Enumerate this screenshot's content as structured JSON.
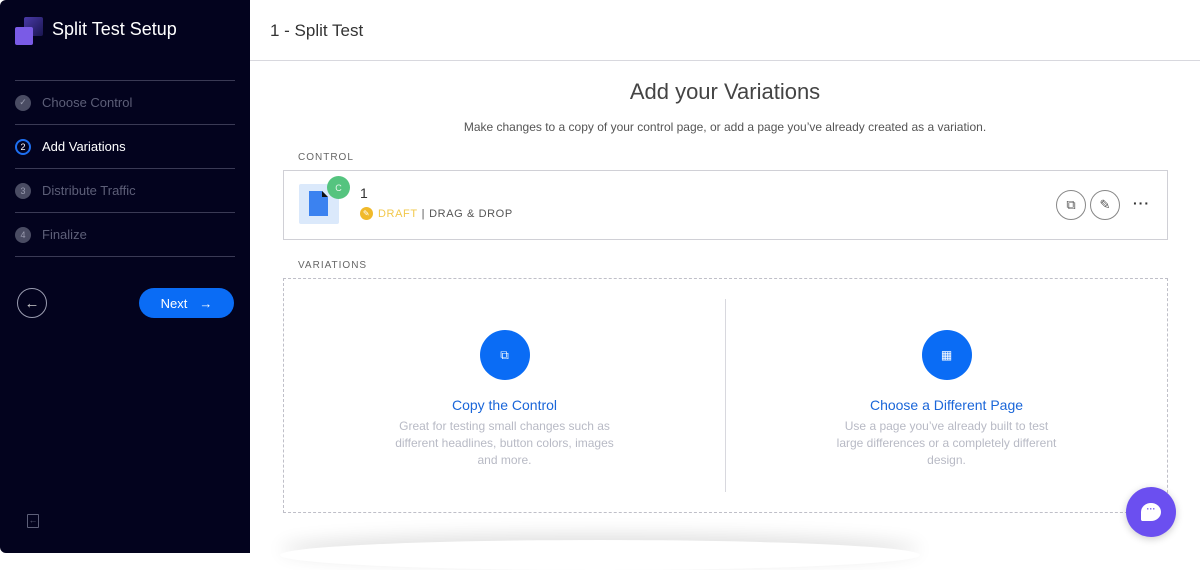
{
  "sidebar": {
    "app_title": "Split Test Setup",
    "steps": [
      {
        "num": "✓",
        "label": "Choose Control",
        "state": "done"
      },
      {
        "num": "2",
        "label": "Add Variations",
        "state": "active"
      },
      {
        "num": "3",
        "label": "Distribute Traffic",
        "state": "pending"
      },
      {
        "num": "4",
        "label": "Finalize",
        "state": "pending"
      }
    ],
    "back_icon": "←",
    "next_label": "Next",
    "next_icon": "→"
  },
  "header": {
    "title": "1 - Split Test"
  },
  "main": {
    "heading": "Add your Variations",
    "subheading": "Make changes to a copy of your control page, or add a page you’ve already created as a variation.",
    "control_label": "CONTROL",
    "control": {
      "badge": "C",
      "name": "1",
      "status": "DRAFT",
      "separator": "|",
      "type": "DRAG & DROP"
    },
    "variations_label": "VARIATIONS",
    "options": [
      {
        "title": "Copy the Control",
        "description": "Great for testing small changes such as different headlines, button colors, images and more.",
        "icon": "copy-icon"
      },
      {
        "title": "Choose a Different Page",
        "description": "Use a page you’ve already built to test large differences or a completely different design.",
        "icon": "grid-icon"
      }
    ]
  },
  "colors": {
    "sidebar_bg": "#03031e",
    "accent": "#0a6cf5",
    "chat": "#6b4ff0",
    "draft": "#f2c84b",
    "control_badge": "#55c47f"
  }
}
